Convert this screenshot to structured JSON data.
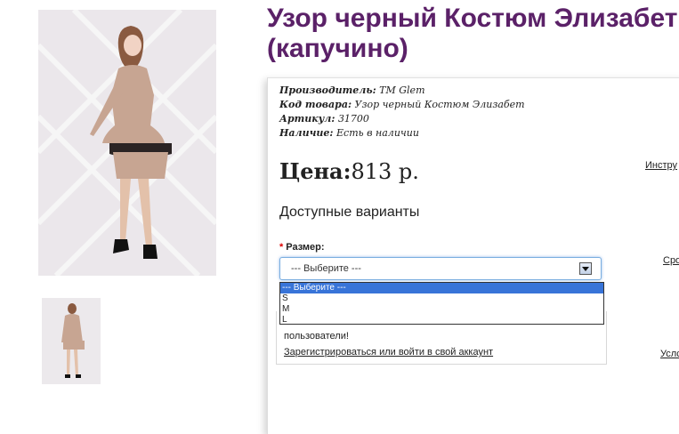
{
  "product": {
    "title": "Узор черный Костюм Элизабет (капучино)",
    "info": [
      {
        "label": "Производитель:",
        "value": "TM Glem"
      },
      {
        "label": "Код товара:",
        "value": "Узор черный Костюм Элизабет"
      },
      {
        "label": "Артикул:",
        "value": "31700"
      },
      {
        "label": "Наличие:",
        "value": "Есть в наличии"
      }
    ],
    "price_label": "Цена:",
    "price_value": "813 р."
  },
  "options": {
    "heading": "Доступные варианты",
    "required_mark": "*",
    "size_label": "Размер:",
    "size_selected": "--- Выберите ---",
    "size_options": [
      "--- Выберите ---",
      "S",
      "M",
      "L"
    ]
  },
  "login_notice": {
    "message": "пользователи!",
    "link": "Зарегистрироваться или войти в свой аккаунт"
  },
  "side_links": [
    "Инстру",
    "Сро",
    "Услс"
  ],
  "colors": {
    "title": "#5b2168",
    "selected_option": "#3874d8"
  }
}
